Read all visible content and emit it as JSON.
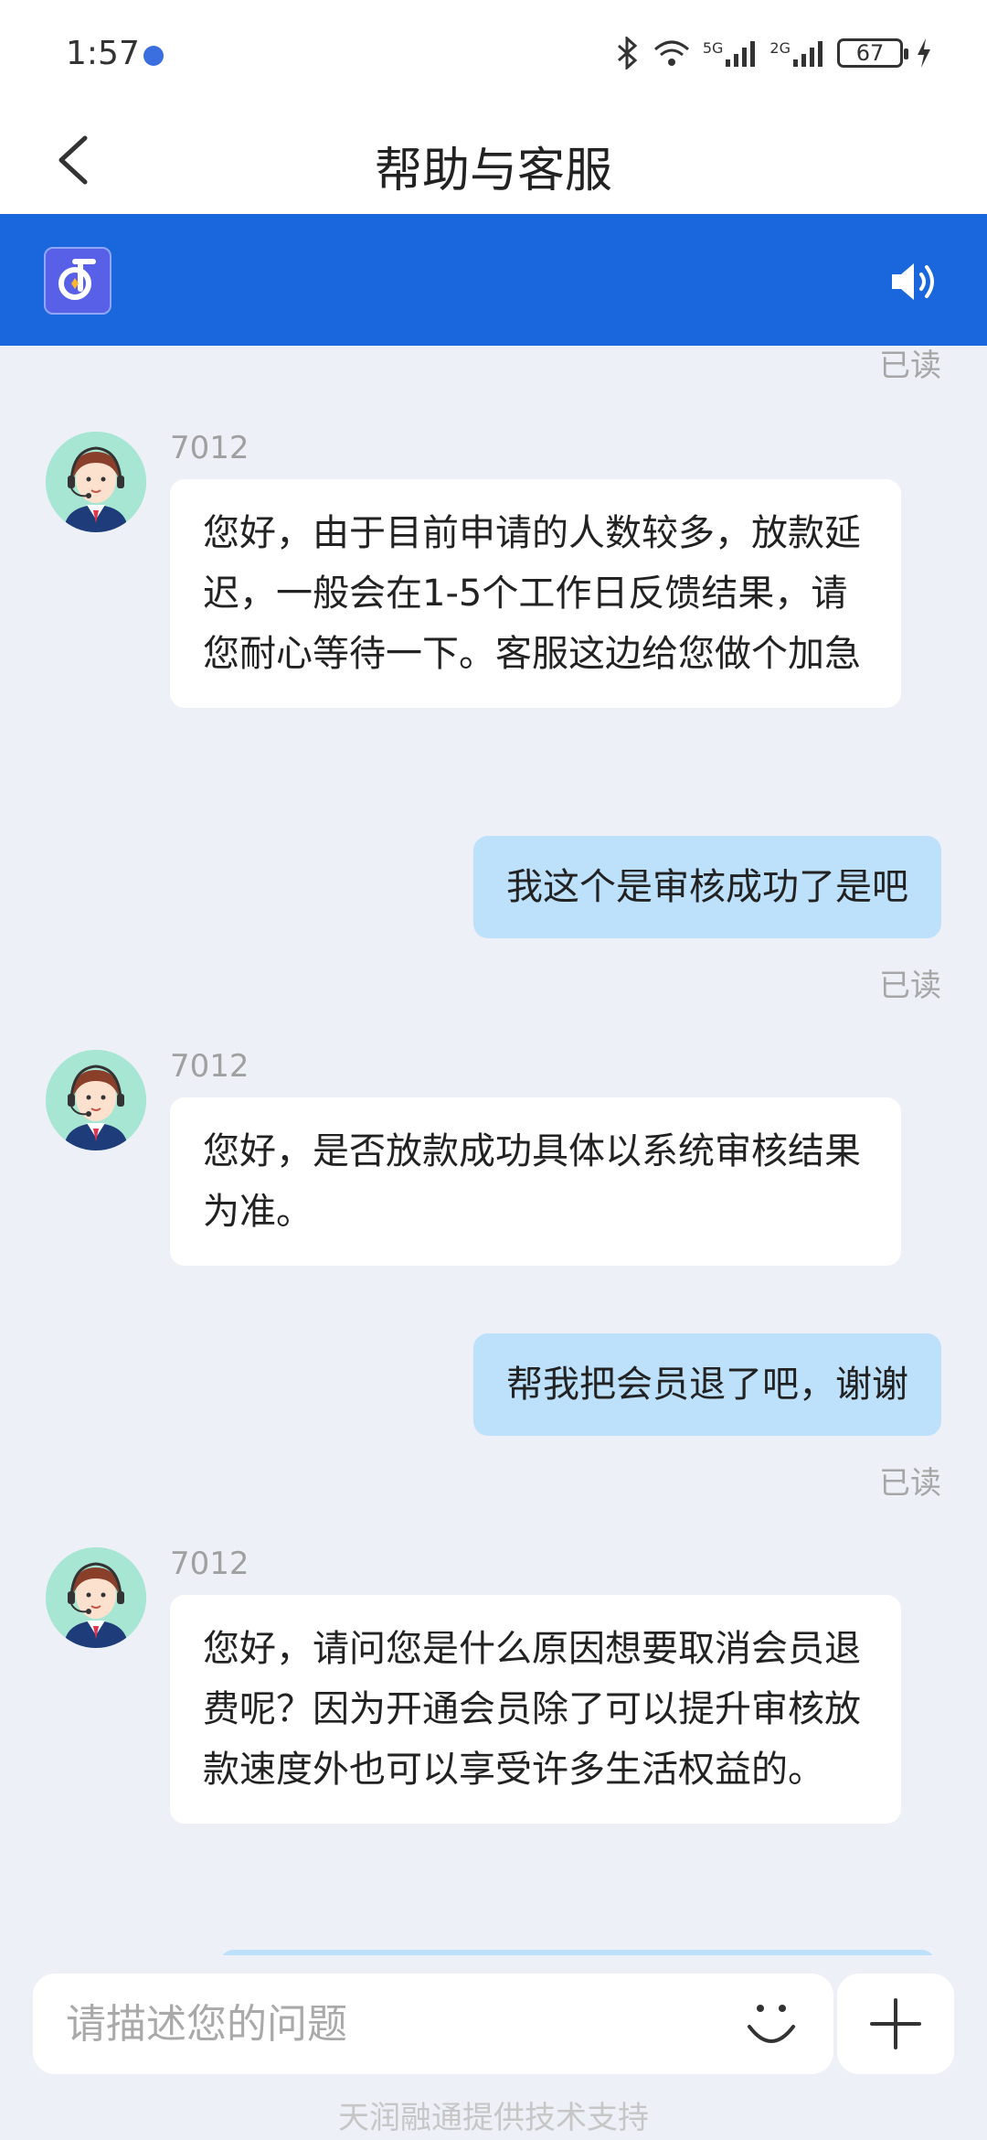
{
  "status_bar": {
    "time": "1:57",
    "network_5g": "5G",
    "network_2g": "2G",
    "battery": "67"
  },
  "header": {
    "title": "帮助与客服"
  },
  "messages": {
    "m0_read": "已读",
    "m1": {
      "sender": "7012",
      "text": "您好，由于目前申请的人数较多，放款延迟，一般会在1-5个工作日反馈结果，请您耐心等待一下。客服这边给您做个加急"
    },
    "m2": {
      "text": "我这个是审核成功了是吧",
      "read": "已读"
    },
    "m3": {
      "sender": "7012",
      "text": "您好，是否放款成功具体以系统审核结果为准。"
    },
    "m4": {
      "text": "帮我把会员退了吧，谢谢",
      "read": "已读"
    },
    "m5": {
      "sender": "7012",
      "text": "您好，请问您是什么原因想要取消会员退费呢？因为开通会员除了可以提升审核放款速度外也可以享受许多生活权益的。"
    }
  },
  "input": {
    "placeholder": "请描述您的问题"
  },
  "footer": {
    "note": "天润融通提供技术支持"
  },
  "colors": {
    "brand_blue": "#1a66dd",
    "user_bubble": "#bde0fb",
    "chat_bg": "#edf0f6"
  }
}
